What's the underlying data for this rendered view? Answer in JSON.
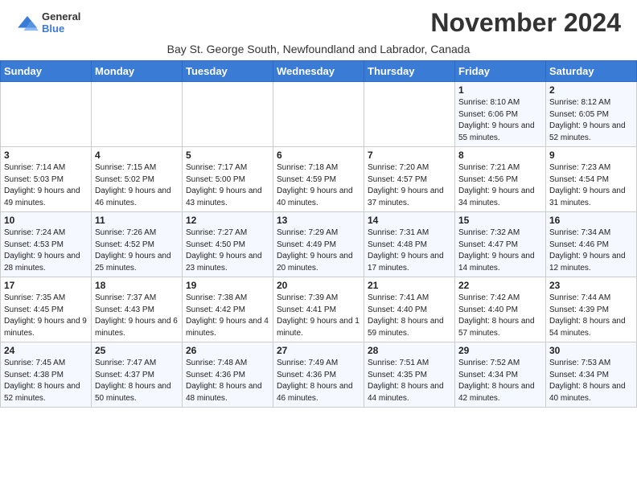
{
  "header": {
    "logo_general": "General",
    "logo_blue": "Blue",
    "title": "November 2024",
    "subtitle": "Bay St. George South, Newfoundland and Labrador, Canada"
  },
  "days_of_week": [
    "Sunday",
    "Monday",
    "Tuesday",
    "Wednesday",
    "Thursday",
    "Friday",
    "Saturday"
  ],
  "weeks": [
    [
      {
        "day": "",
        "info": ""
      },
      {
        "day": "",
        "info": ""
      },
      {
        "day": "",
        "info": ""
      },
      {
        "day": "",
        "info": ""
      },
      {
        "day": "",
        "info": ""
      },
      {
        "day": "1",
        "info": "Sunrise: 8:10 AM\nSunset: 6:06 PM\nDaylight: 9 hours\nand 55 minutes."
      },
      {
        "day": "2",
        "info": "Sunrise: 8:12 AM\nSunset: 6:05 PM\nDaylight: 9 hours\nand 52 minutes."
      }
    ],
    [
      {
        "day": "3",
        "info": "Sunrise: 7:14 AM\nSunset: 5:03 PM\nDaylight: 9 hours\nand 49 minutes."
      },
      {
        "day": "4",
        "info": "Sunrise: 7:15 AM\nSunset: 5:02 PM\nDaylight: 9 hours\nand 46 minutes."
      },
      {
        "day": "5",
        "info": "Sunrise: 7:17 AM\nSunset: 5:00 PM\nDaylight: 9 hours\nand 43 minutes."
      },
      {
        "day": "6",
        "info": "Sunrise: 7:18 AM\nSunset: 4:59 PM\nDaylight: 9 hours\nand 40 minutes."
      },
      {
        "day": "7",
        "info": "Sunrise: 7:20 AM\nSunset: 4:57 PM\nDaylight: 9 hours\nand 37 minutes."
      },
      {
        "day": "8",
        "info": "Sunrise: 7:21 AM\nSunset: 4:56 PM\nDaylight: 9 hours\nand 34 minutes."
      },
      {
        "day": "9",
        "info": "Sunrise: 7:23 AM\nSunset: 4:54 PM\nDaylight: 9 hours\nand 31 minutes."
      }
    ],
    [
      {
        "day": "10",
        "info": "Sunrise: 7:24 AM\nSunset: 4:53 PM\nDaylight: 9 hours\nand 28 minutes."
      },
      {
        "day": "11",
        "info": "Sunrise: 7:26 AM\nSunset: 4:52 PM\nDaylight: 9 hours\nand 25 minutes."
      },
      {
        "day": "12",
        "info": "Sunrise: 7:27 AM\nSunset: 4:50 PM\nDaylight: 9 hours\nand 23 minutes."
      },
      {
        "day": "13",
        "info": "Sunrise: 7:29 AM\nSunset: 4:49 PM\nDaylight: 9 hours\nand 20 minutes."
      },
      {
        "day": "14",
        "info": "Sunrise: 7:31 AM\nSunset: 4:48 PM\nDaylight: 9 hours\nand 17 minutes."
      },
      {
        "day": "15",
        "info": "Sunrise: 7:32 AM\nSunset: 4:47 PM\nDaylight: 9 hours\nand 14 minutes."
      },
      {
        "day": "16",
        "info": "Sunrise: 7:34 AM\nSunset: 4:46 PM\nDaylight: 9 hours\nand 12 minutes."
      }
    ],
    [
      {
        "day": "17",
        "info": "Sunrise: 7:35 AM\nSunset: 4:45 PM\nDaylight: 9 hours\nand 9 minutes."
      },
      {
        "day": "18",
        "info": "Sunrise: 7:37 AM\nSunset: 4:43 PM\nDaylight: 9 hours\nand 6 minutes."
      },
      {
        "day": "19",
        "info": "Sunrise: 7:38 AM\nSunset: 4:42 PM\nDaylight: 9 hours\nand 4 minutes."
      },
      {
        "day": "20",
        "info": "Sunrise: 7:39 AM\nSunset: 4:41 PM\nDaylight: 9 hours\nand 1 minute."
      },
      {
        "day": "21",
        "info": "Sunrise: 7:41 AM\nSunset: 4:40 PM\nDaylight: 8 hours\nand 59 minutes."
      },
      {
        "day": "22",
        "info": "Sunrise: 7:42 AM\nSunset: 4:40 PM\nDaylight: 8 hours\nand 57 minutes."
      },
      {
        "day": "23",
        "info": "Sunrise: 7:44 AM\nSunset: 4:39 PM\nDaylight: 8 hours\nand 54 minutes."
      }
    ],
    [
      {
        "day": "24",
        "info": "Sunrise: 7:45 AM\nSunset: 4:38 PM\nDaylight: 8 hours\nand 52 minutes."
      },
      {
        "day": "25",
        "info": "Sunrise: 7:47 AM\nSunset: 4:37 PM\nDaylight: 8 hours\nand 50 minutes."
      },
      {
        "day": "26",
        "info": "Sunrise: 7:48 AM\nSunset: 4:36 PM\nDaylight: 8 hours\nand 48 minutes."
      },
      {
        "day": "27",
        "info": "Sunrise: 7:49 AM\nSunset: 4:36 PM\nDaylight: 8 hours\nand 46 minutes."
      },
      {
        "day": "28",
        "info": "Sunrise: 7:51 AM\nSunset: 4:35 PM\nDaylight: 8 hours\nand 44 minutes."
      },
      {
        "day": "29",
        "info": "Sunrise: 7:52 AM\nSunset: 4:34 PM\nDaylight: 8 hours\nand 42 minutes."
      },
      {
        "day": "30",
        "info": "Sunrise: 7:53 AM\nSunset: 4:34 PM\nDaylight: 8 hours\nand 40 minutes."
      }
    ]
  ]
}
